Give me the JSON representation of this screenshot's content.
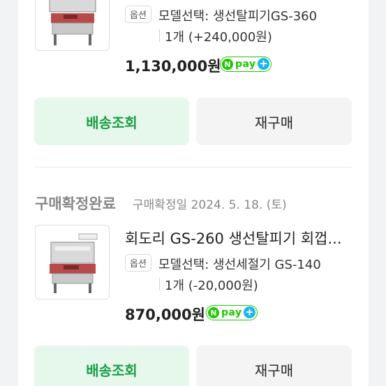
{
  "orders": [
    {
      "option_badge": "옵션",
      "option_text": "모델선택: 생선탈피기GS-360",
      "quantity_text": "1개 (+240,000원)",
      "price": "1,130,000원",
      "pay_label": "pay",
      "track_button": "배송조회",
      "rebuy_button": "재구매"
    },
    {
      "status": "구매확정완료",
      "status_date": "구매확정일 2024. 5. 18. (토)",
      "title": "회도리 GS-260 생선탈피기 회껍...",
      "option_badge": "옵션",
      "option_text": "모델선택: 생선세절기 GS-140",
      "quantity_text": "1개 (-20,000원)",
      "price": "870,000원",
      "pay_label": "pay",
      "track_button": "배송조회",
      "rebuy_button": "재구매"
    }
  ],
  "colors": {
    "accent_green": "#1a9e46",
    "npay_green": "#1ec800",
    "npay_plus_blue": "#1bb7e8"
  },
  "icons": {
    "npay_logo": "naver-pay-icon",
    "product_image": "fish-skinning-machine-icon"
  }
}
